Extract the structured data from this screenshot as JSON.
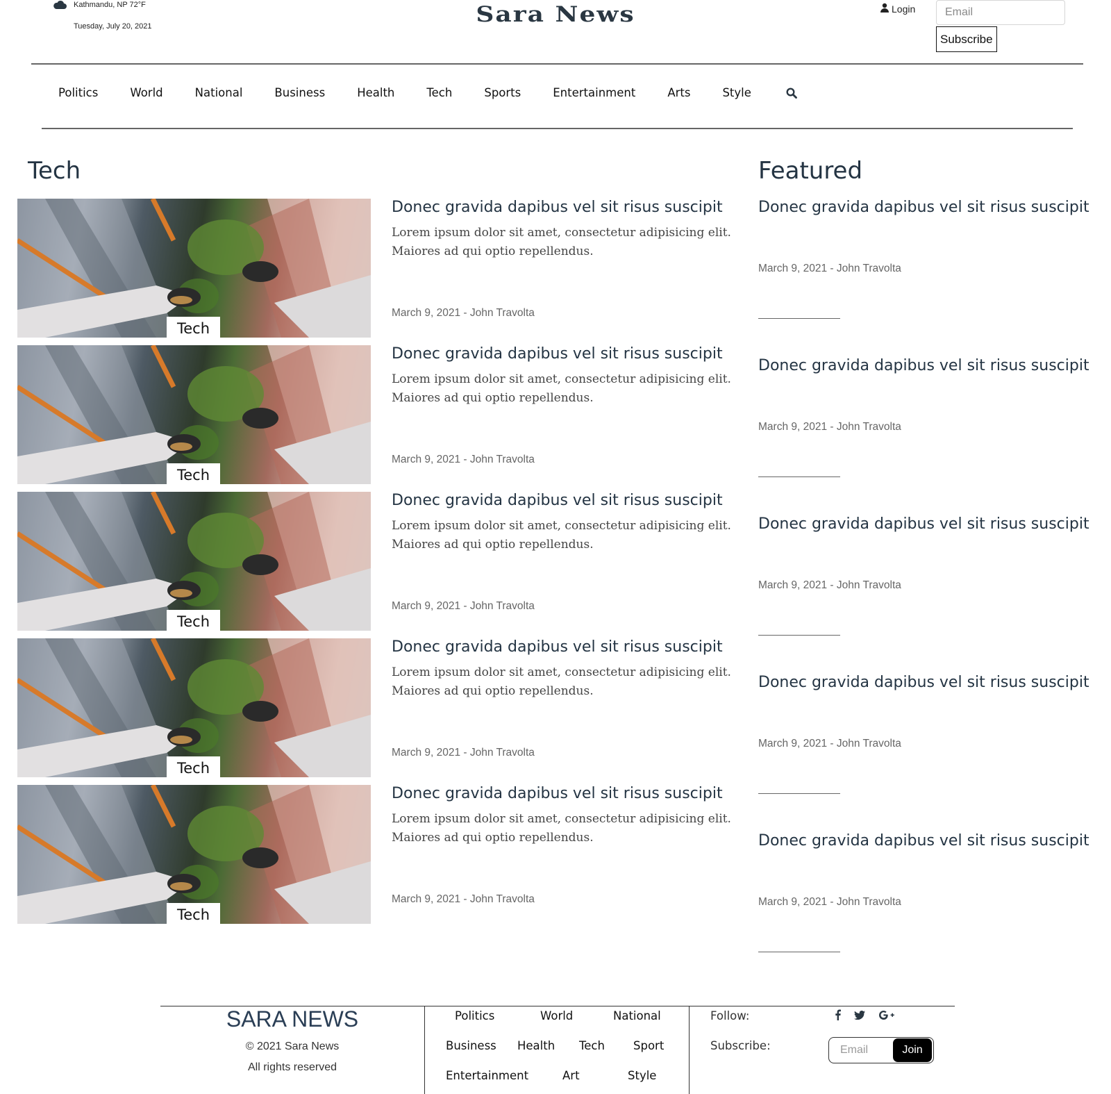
{
  "header": {
    "weather": "Kathmandu, NP 72°F",
    "date": "Tuesday, July 20, 2021",
    "logo": "Sara News",
    "login_label": "Login",
    "email_placeholder": "Email",
    "subscribe_label": "Subscribe"
  },
  "nav": {
    "items": [
      "Politics",
      "World",
      "National",
      "Business",
      "Health",
      "Tech",
      "Sports",
      "Entertainment",
      "Arts",
      "Style"
    ],
    "search_icon": "search-icon"
  },
  "section": {
    "title": "Tech",
    "featured_title": "Featured"
  },
  "articles": [
    {
      "tag": "Tech",
      "title": "Donec gravida dapibus vel sit risus suscipit",
      "excerpt": "Lorem ipsum dolor sit amet, consectetur adipisicing elit. Maiores ad qui optio repellendus.",
      "meta": "March 9, 2021 - John Travolta"
    },
    {
      "tag": "Tech",
      "title": "Donec gravida dapibus vel sit risus suscipit",
      "excerpt": "Lorem ipsum dolor sit amet, consectetur adipisicing elit. Maiores ad qui optio repellendus.",
      "meta": "March 9, 2021 - John Travolta"
    },
    {
      "tag": "Tech",
      "title": "Donec gravida dapibus vel sit risus suscipit",
      "excerpt": "Lorem ipsum dolor sit amet, consectetur adipisicing elit. Maiores ad qui optio repellendus.",
      "meta": "March 9, 2021 - John Travolta"
    },
    {
      "tag": "Tech",
      "title": "Donec gravida dapibus vel sit risus suscipit",
      "excerpt": "Lorem ipsum dolor sit amet, consectetur adipisicing elit. Maiores ad qui optio repellendus.",
      "meta": "March 9, 2021 - John Travolta"
    },
    {
      "tag": "Tech",
      "title": "Donec gravida dapibus vel sit risus suscipit",
      "excerpt": "Lorem ipsum dolor sit amet, consectetur adipisicing elit. Maiores ad qui optio repellendus.",
      "meta": "March 9, 2021 - John Travolta"
    }
  ],
  "featured": [
    {
      "title": "Donec gravida dapibus vel sit risus suscipit",
      "meta": "March 9, 2021 - John Travolta"
    },
    {
      "title": "Donec gravida dapibus vel sit risus suscipit",
      "meta": "March 9, 2021 - John Travolta"
    },
    {
      "title": "Donec gravida dapibus vel sit risus suscipit",
      "meta": "March 9, 2021 - John Travolta"
    },
    {
      "title": "Donec gravida dapibus vel sit risus suscipit",
      "meta": "March 9, 2021 - John Travolta"
    },
    {
      "title": "Donec gravida dapibus vel sit risus suscipit",
      "meta": "March 9, 2021 - John Travolta"
    }
  ],
  "footer": {
    "brand": "SARA NEWS",
    "copyright": "© 2021 Sara News",
    "rights": "All rights reserved",
    "links": [
      "Politics",
      "World",
      "National",
      "Business",
      "Health",
      "Tech",
      "Sport",
      "Entertainment",
      "Art",
      "Style"
    ],
    "follow_label": "Follow:",
    "subscribe_label": "Subscribe:",
    "social_icons": [
      "facebook-icon",
      "twitter-icon",
      "google-plus-icon"
    ],
    "email_placeholder": "Email",
    "join_label": "Join"
  },
  "colors": {
    "heading": "#243443",
    "text": "#444444",
    "meta": "#666666",
    "join_button": "#000000"
  }
}
